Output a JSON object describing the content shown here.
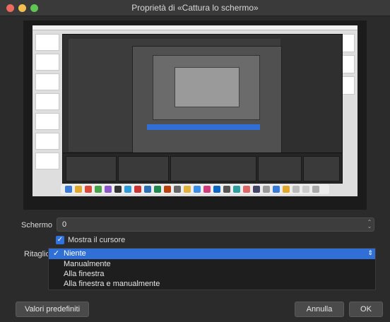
{
  "window": {
    "title": "Proprietà di «Cattura lo schermo»"
  },
  "form": {
    "screen_label": "Schermo",
    "screen_value": "0",
    "cursor_checkbox_label": "Mostra il cursore",
    "cursor_checked": true,
    "crop_label": "Ritaglio",
    "crop_options": [
      "Niente",
      "Manualmente",
      "Alla finestra",
      "Alla finestra e manualmente"
    ],
    "crop_selected": "Niente"
  },
  "buttons": {
    "defaults": "Valori predefiniti",
    "cancel": "Annulla",
    "ok": "OK"
  },
  "colors": {
    "accent": "#2f6fd6",
    "background": "#2b2b2b"
  }
}
